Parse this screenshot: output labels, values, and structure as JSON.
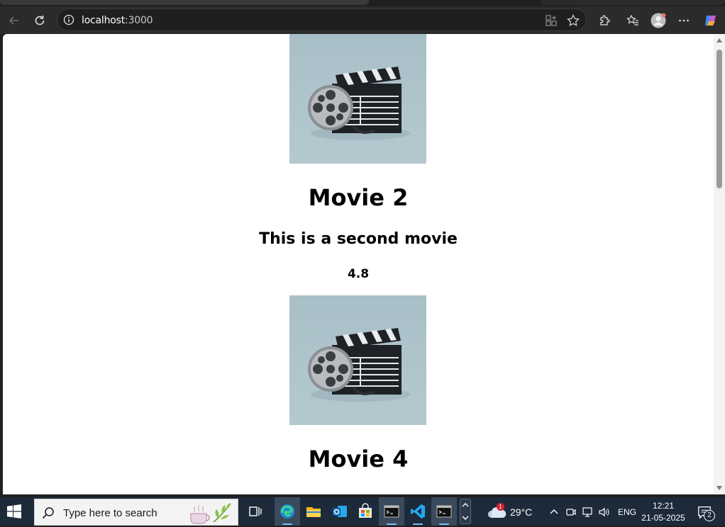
{
  "browser": {
    "url_host": "localhost",
    "url_port": ":3000"
  },
  "movies": [
    {
      "title": "Movie 2",
      "description": "This is a second movie",
      "rating": "4.8"
    },
    {
      "title": "Movie 4"
    }
  ],
  "taskbar": {
    "search_placeholder": "Type here to search",
    "weather_temp": "29°C",
    "weather_badge": "1",
    "language": "ENG",
    "time": "12:21",
    "date": "21-05-2025",
    "notification_count": "2"
  },
  "colors": {
    "poster_bg": "#abc1c8",
    "taskbar_bg": "#1c2a3a",
    "toolbar_bg": "#2b2b2b"
  }
}
